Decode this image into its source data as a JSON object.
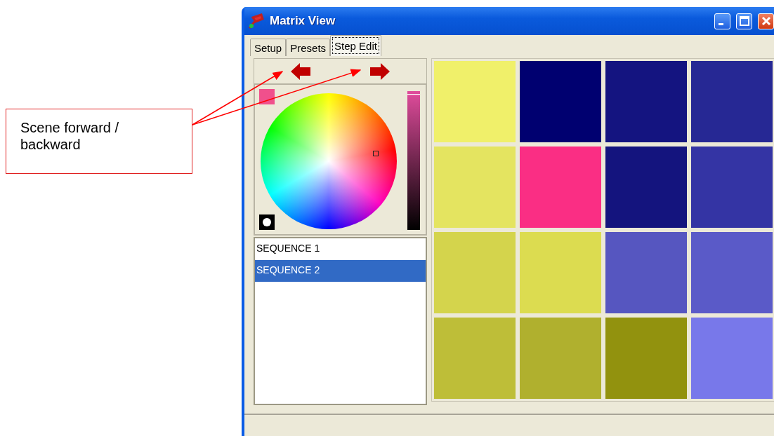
{
  "annotation": {
    "text": "Scene forward / backward"
  },
  "window": {
    "title": "Matrix View"
  },
  "tabs": [
    {
      "label": "Setup",
      "selected": false
    },
    {
      "label": "Presets",
      "selected": false
    },
    {
      "label": "Step Edit",
      "selected": true
    }
  ],
  "brightness": {
    "level": 0.98
  },
  "sequences": [
    {
      "label": "SEQUENCE 1",
      "selected": false
    },
    {
      "label": "SEQUENCE 2",
      "selected": true
    }
  ],
  "grid": [
    {
      "color": "#f0f06a"
    },
    {
      "color": "#000070"
    },
    {
      "color": "#141480"
    },
    {
      "color": "#262894"
    },
    {
      "color": "#e4e460"
    },
    {
      "color": "#fa2e84"
    },
    {
      "color": "#14147e"
    },
    {
      "color": "#3434a4"
    },
    {
      "color": "#d4d44c"
    },
    {
      "color": "#dcdc50"
    },
    {
      "color": "#5656c0"
    },
    {
      "color": "#5a5ac8"
    },
    {
      "color": "#bebe38"
    },
    {
      "color": "#b0b02e"
    },
    {
      "color": "#92920e"
    },
    {
      "color": "#7878ea"
    }
  ]
}
